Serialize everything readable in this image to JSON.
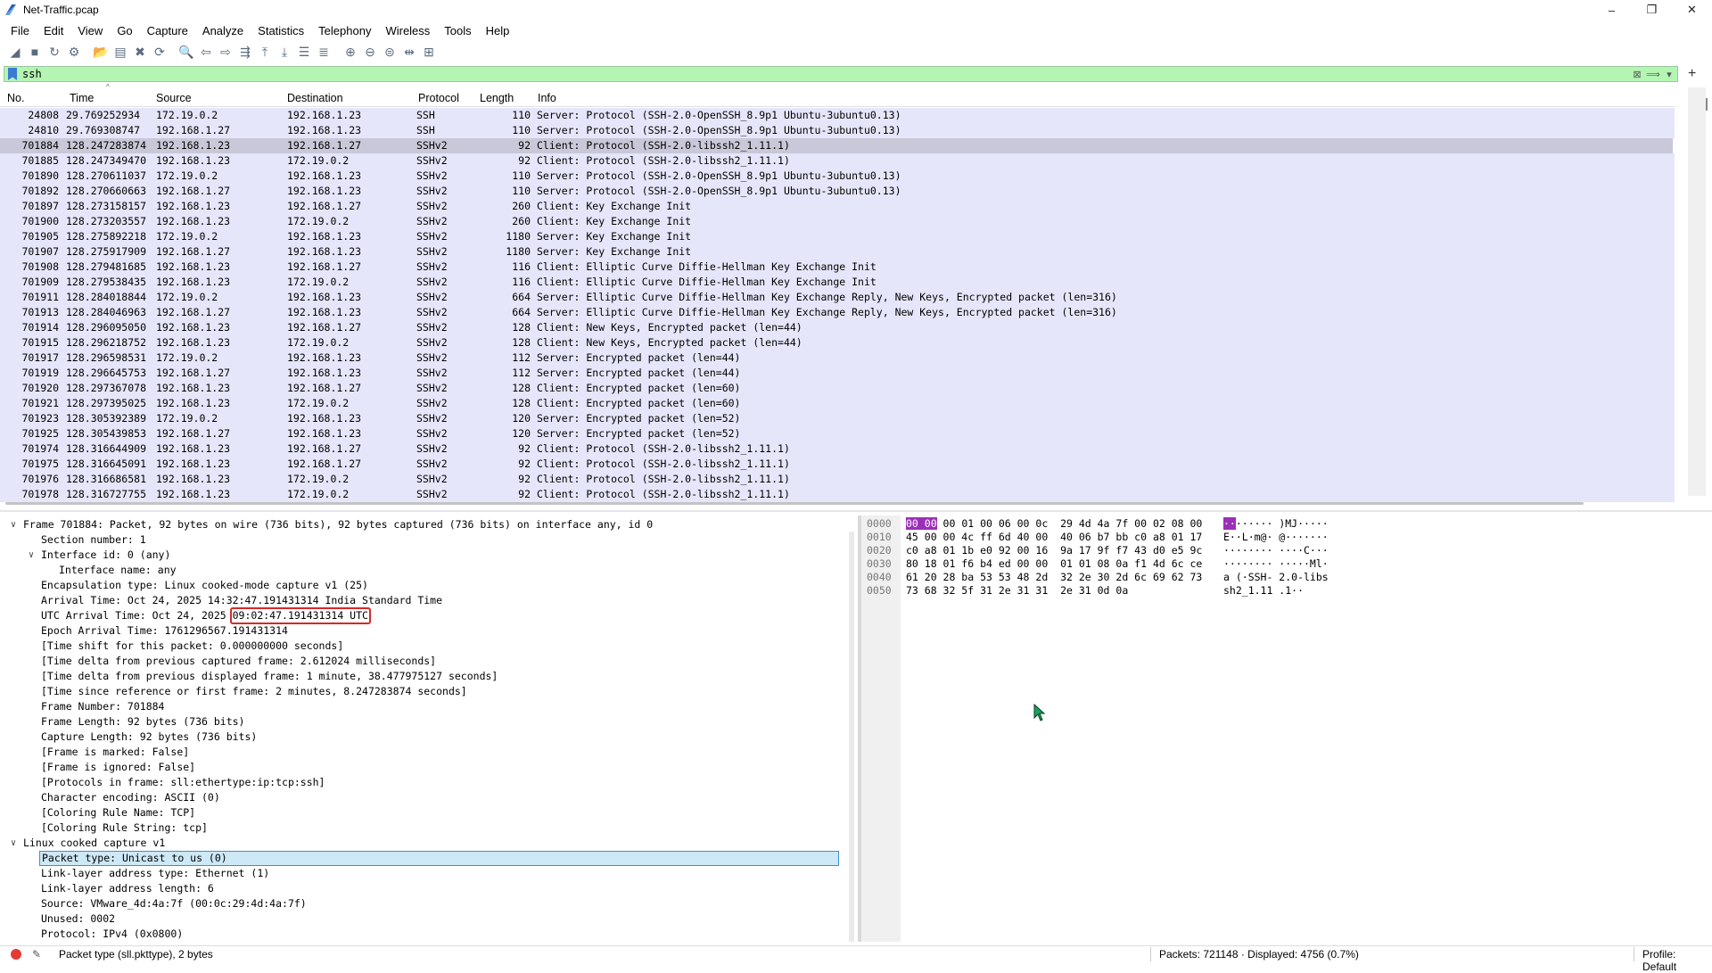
{
  "window": {
    "title": "Net-Traffic.pcap",
    "minimize": "–",
    "maximize": "❐",
    "close": "✕"
  },
  "menu": [
    "File",
    "Edit",
    "View",
    "Go",
    "Capture",
    "Analyze",
    "Statistics",
    "Telephony",
    "Wireless",
    "Tools",
    "Help"
  ],
  "filter": {
    "value": "ssh"
  },
  "columns": {
    "no": "No.",
    "time": "Time",
    "source": "Source",
    "destination": "Destination",
    "protocol": "Protocol",
    "length": "Length",
    "info": "Info"
  },
  "packets": [
    {
      "no": "24808",
      "time": "29.769252934",
      "src": "172.19.0.2",
      "dst": "192.168.1.23",
      "proto": "SSH",
      "len": "110",
      "info": "Server: Protocol (SSH-2.0-OpenSSH_8.9p1 Ubuntu-3ubuntu0.13)"
    },
    {
      "no": "24810",
      "time": "29.769308747",
      "src": "192.168.1.27",
      "dst": "192.168.1.23",
      "proto": "SSH",
      "len": "110",
      "info": "Server: Protocol (SSH-2.0-OpenSSH_8.9p1 Ubuntu-3ubuntu0.13)"
    },
    {
      "no": "701884",
      "time": "128.247283874",
      "src": "192.168.1.23",
      "dst": "192.168.1.27",
      "proto": "SSHv2",
      "len": "92",
      "info": "Client: Protocol (SSH-2.0-libssh2_1.11.1)",
      "selected": true
    },
    {
      "no": "701885",
      "time": "128.247349470",
      "src": "192.168.1.23",
      "dst": "172.19.0.2",
      "proto": "SSHv2",
      "len": "92",
      "info": "Client: Protocol (SSH-2.0-libssh2_1.11.1)"
    },
    {
      "no": "701890",
      "time": "128.270611037",
      "src": "172.19.0.2",
      "dst": "192.168.1.23",
      "proto": "SSHv2",
      "len": "110",
      "info": "Server: Protocol (SSH-2.0-OpenSSH_8.9p1 Ubuntu-3ubuntu0.13)"
    },
    {
      "no": "701892",
      "time": "128.270660663",
      "src": "192.168.1.27",
      "dst": "192.168.1.23",
      "proto": "SSHv2",
      "len": "110",
      "info": "Server: Protocol (SSH-2.0-OpenSSH_8.9p1 Ubuntu-3ubuntu0.13)"
    },
    {
      "no": "701897",
      "time": "128.273158157",
      "src": "192.168.1.23",
      "dst": "192.168.1.27",
      "proto": "SSHv2",
      "len": "260",
      "info": "Client: Key Exchange Init"
    },
    {
      "no": "701900",
      "time": "128.273203557",
      "src": "192.168.1.23",
      "dst": "172.19.0.2",
      "proto": "SSHv2",
      "len": "260",
      "info": "Client: Key Exchange Init"
    },
    {
      "no": "701905",
      "time": "128.275892218",
      "src": "172.19.0.2",
      "dst": "192.168.1.23",
      "proto": "SSHv2",
      "len": "1180",
      "info": "Server: Key Exchange Init"
    },
    {
      "no": "701907",
      "time": "128.275917909",
      "src": "192.168.1.27",
      "dst": "192.168.1.23",
      "proto": "SSHv2",
      "len": "1180",
      "info": "Server: Key Exchange Init"
    },
    {
      "no": "701908",
      "time": "128.279481685",
      "src": "192.168.1.23",
      "dst": "192.168.1.27",
      "proto": "SSHv2",
      "len": "116",
      "info": "Client: Elliptic Curve Diffie-Hellman Key Exchange Init"
    },
    {
      "no": "701909",
      "time": "128.279538435",
      "src": "192.168.1.23",
      "dst": "172.19.0.2",
      "proto": "SSHv2",
      "len": "116",
      "info": "Client: Elliptic Curve Diffie-Hellman Key Exchange Init"
    },
    {
      "no": "701911",
      "time": "128.284018844",
      "src": "172.19.0.2",
      "dst": "192.168.1.23",
      "proto": "SSHv2",
      "len": "664",
      "info": "Server: Elliptic Curve Diffie-Hellman Key Exchange Reply, New Keys, Encrypted packet (len=316)"
    },
    {
      "no": "701913",
      "time": "128.284046963",
      "src": "192.168.1.27",
      "dst": "192.168.1.23",
      "proto": "SSHv2",
      "len": "664",
      "info": "Server: Elliptic Curve Diffie-Hellman Key Exchange Reply, New Keys, Encrypted packet (len=316)"
    },
    {
      "no": "701914",
      "time": "128.296095050",
      "src": "192.168.1.23",
      "dst": "192.168.1.27",
      "proto": "SSHv2",
      "len": "128",
      "info": "Client: New Keys, Encrypted packet (len=44)"
    },
    {
      "no": "701915",
      "time": "128.296218752",
      "src": "192.168.1.23",
      "dst": "172.19.0.2",
      "proto": "SSHv2",
      "len": "128",
      "info": "Client: New Keys, Encrypted packet (len=44)"
    },
    {
      "no": "701917",
      "time": "128.296598531",
      "src": "172.19.0.2",
      "dst": "192.168.1.23",
      "proto": "SSHv2",
      "len": "112",
      "info": "Server: Encrypted packet (len=44)"
    },
    {
      "no": "701919",
      "time": "128.296645753",
      "src": "192.168.1.27",
      "dst": "192.168.1.23",
      "proto": "SSHv2",
      "len": "112",
      "info": "Server: Encrypted packet (len=44)"
    },
    {
      "no": "701920",
      "time": "128.297367078",
      "src": "192.168.1.23",
      "dst": "192.168.1.27",
      "proto": "SSHv2",
      "len": "128",
      "info": "Client: Encrypted packet (len=60)"
    },
    {
      "no": "701921",
      "time": "128.297395025",
      "src": "192.168.1.23",
      "dst": "172.19.0.2",
      "proto": "SSHv2",
      "len": "128",
      "info": "Client: Encrypted packet (len=60)"
    },
    {
      "no": "701923",
      "time": "128.305392389",
      "src": "172.19.0.2",
      "dst": "192.168.1.23",
      "proto": "SSHv2",
      "len": "120",
      "info": "Server: Encrypted packet (len=52)"
    },
    {
      "no": "701925",
      "time": "128.305439853",
      "src": "192.168.1.27",
      "dst": "192.168.1.23",
      "proto": "SSHv2",
      "len": "120",
      "info": "Server: Encrypted packet (len=52)"
    },
    {
      "no": "701974",
      "time": "128.316644909",
      "src": "192.168.1.23",
      "dst": "192.168.1.27",
      "proto": "SSHv2",
      "len": "92",
      "info": "Client: Protocol (SSH-2.0-libssh2_1.11.1)"
    },
    {
      "no": "701975",
      "time": "128.316645091",
      "src": "192.168.1.23",
      "dst": "192.168.1.27",
      "proto": "SSHv2",
      "len": "92",
      "info": "Client: Protocol (SSH-2.0-libssh2_1.11.1)"
    },
    {
      "no": "701976",
      "time": "128.316686581",
      "src": "192.168.1.23",
      "dst": "172.19.0.2",
      "proto": "SSHv2",
      "len": "92",
      "info": "Client: Protocol (SSH-2.0-libssh2_1.11.1)"
    },
    {
      "no": "701978",
      "time": "128.316727755",
      "src": "192.168.1.23",
      "dst": "172.19.0.2",
      "proto": "SSHv2",
      "len": "92",
      "info": "Client: Protocol (SSH-2.0-libssh2_1.11.1)"
    }
  ],
  "details": [
    {
      "level": 0,
      "toggle": "v",
      "text": "Frame 701884: Packet, 92 bytes on wire (736 bits), 92 bytes captured (736 bits) on interface any, id 0"
    },
    {
      "level": 1,
      "text": "Section number: 1"
    },
    {
      "level": 1,
      "toggle": "v",
      "text": "Interface id: 0 (any)"
    },
    {
      "level": 2,
      "text": "Interface name: any"
    },
    {
      "level": 1,
      "text": "Encapsulation type: Linux cooked-mode capture v1 (25)"
    },
    {
      "level": 1,
      "text": "Arrival Time: Oct 24, 2025 14:32:47.191431314 India Standard Time"
    },
    {
      "level": 1,
      "text": "UTC Arrival Time: Oct 24, 2025 09:02:47.191431314 UTC",
      "boxed": "09:02:47.191431314 UTC"
    },
    {
      "level": 1,
      "text": "Epoch Arrival Time: 1761296567.191431314"
    },
    {
      "level": 1,
      "text": "[Time shift for this packet: 0.000000000 seconds]"
    },
    {
      "level": 1,
      "text": "[Time delta from previous captured frame: 2.612024 milliseconds]"
    },
    {
      "level": 1,
      "text": "[Time delta from previous displayed frame: 1 minute, 38.477975127 seconds]"
    },
    {
      "level": 1,
      "text": "[Time since reference or first frame: 2 minutes, 8.247283874 seconds]"
    },
    {
      "level": 1,
      "text": "Frame Number: 701884"
    },
    {
      "level": 1,
      "text": "Frame Length: 92 bytes (736 bits)"
    },
    {
      "level": 1,
      "text": "Capture Length: 92 bytes (736 bits)"
    },
    {
      "level": 1,
      "text": "[Frame is marked: False]"
    },
    {
      "level": 1,
      "text": "[Frame is ignored: False]"
    },
    {
      "level": 1,
      "text": "[Protocols in frame: sll:ethertype:ip:tcp:ssh]"
    },
    {
      "level": 1,
      "text": "Character encoding: ASCII (0)"
    },
    {
      "level": 1,
      "text": "[Coloring Rule Name: TCP]"
    },
    {
      "level": 1,
      "text": "[Coloring Rule String: tcp]"
    },
    {
      "level": 0,
      "toggle": "v",
      "text": "Linux cooked capture v1"
    },
    {
      "level": 1,
      "text": "Packet type: Unicast to us (0)",
      "highlighted": true
    },
    {
      "level": 1,
      "text": "Link-layer address type: Ethernet (1)"
    },
    {
      "level": 1,
      "text": "Link-layer address length: 6"
    },
    {
      "level": 1,
      "text": "Source: VMware_4d:4a:7f (00:0c:29:4d:4a:7f)"
    },
    {
      "level": 1,
      "text": "Unused: 0002"
    },
    {
      "level": 1,
      "text": "Protocol: IPv4 (0x0800)"
    }
  ],
  "bytes": [
    {
      "offset": "0000",
      "hex": "00 00 00 01 00 06 00 0c  29 4d 4a 7f 00 02 08 00",
      "ascii": "········ )MJ·····"
    },
    {
      "offset": "0010",
      "hex": "45 00 00 4c ff 6d 40 00  40 06 b7 bb c0 a8 01 17",
      "ascii": "E··L·m@· @·······"
    },
    {
      "offset": "0020",
      "hex": "c0 a8 01 1b e0 92 00 16  9a 17 9f f7 43 d0 e5 9c",
      "ascii": "········ ····C···"
    },
    {
      "offset": "0030",
      "hex": "80 18 01 f6 b4 ed 00 00  01 01 08 0a f1 4d 6c ce",
      "ascii": "········ ·····Ml·"
    },
    {
      "offset": "0040",
      "hex": "61 20 28 ba 53 53 48 2d  32 2e 30 2d 6c 69 62 73",
      "ascii": "a (·SSH- 2.0-libs"
    },
    {
      "offset": "0050",
      "hex": "73 68 32 5f 31 2e 31 31  2e 31 0d 0a",
      "ascii": "sh2_1.11 .1··"
    }
  ],
  "status": {
    "field": "Packet type (sll.pkttype), 2 bytes",
    "packets": "Packets: 721148 · Displayed: 4756 (0.7%)",
    "profile": "Profile: Default"
  },
  "colors": {
    "filter_valid": "#b4f5b4",
    "row_bg": "#e6e6fa",
    "selected_row": "#c8c8d8",
    "byte_highlight": "#9b30b8",
    "annotation_box": "#d62828"
  }
}
